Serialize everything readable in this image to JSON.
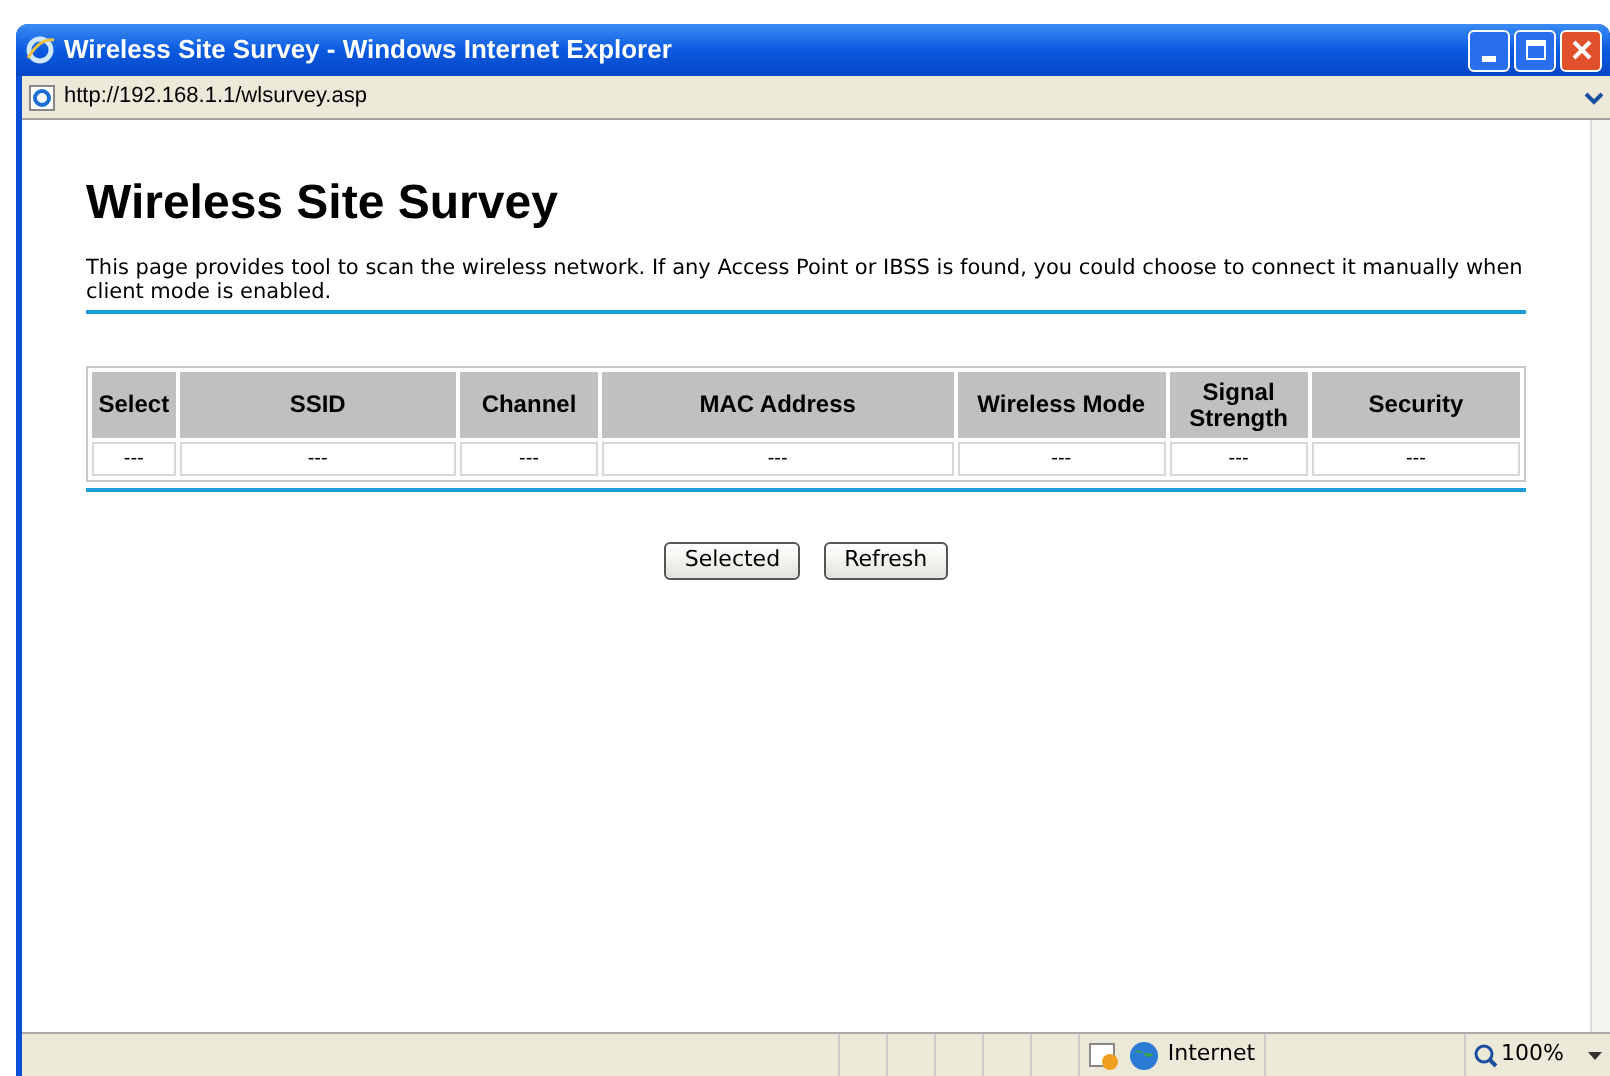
{
  "window": {
    "title": "Wireless Site Survey - Windows Internet Explorer"
  },
  "address": "http://192.168.1.1/wlsurvey.asp",
  "page": {
    "heading": "Wireless Site Survey",
    "description": "This page provides tool to scan the wireless network. If any Access Point or IBSS is found, you could choose to connect it manually when client mode is enabled."
  },
  "table": {
    "columns": [
      "Select",
      "SSID",
      "Channel",
      "MAC Address",
      "Wireless Mode",
      "Signal Strength",
      "Security"
    ],
    "rows": [
      [
        "---",
        "---",
        "---",
        "---",
        "---",
        "---",
        "---"
      ]
    ]
  },
  "buttons": [
    "Selected",
    "Refresh"
  ],
  "status_bar": {
    "zone": "Internet",
    "zoom": "100%"
  }
}
